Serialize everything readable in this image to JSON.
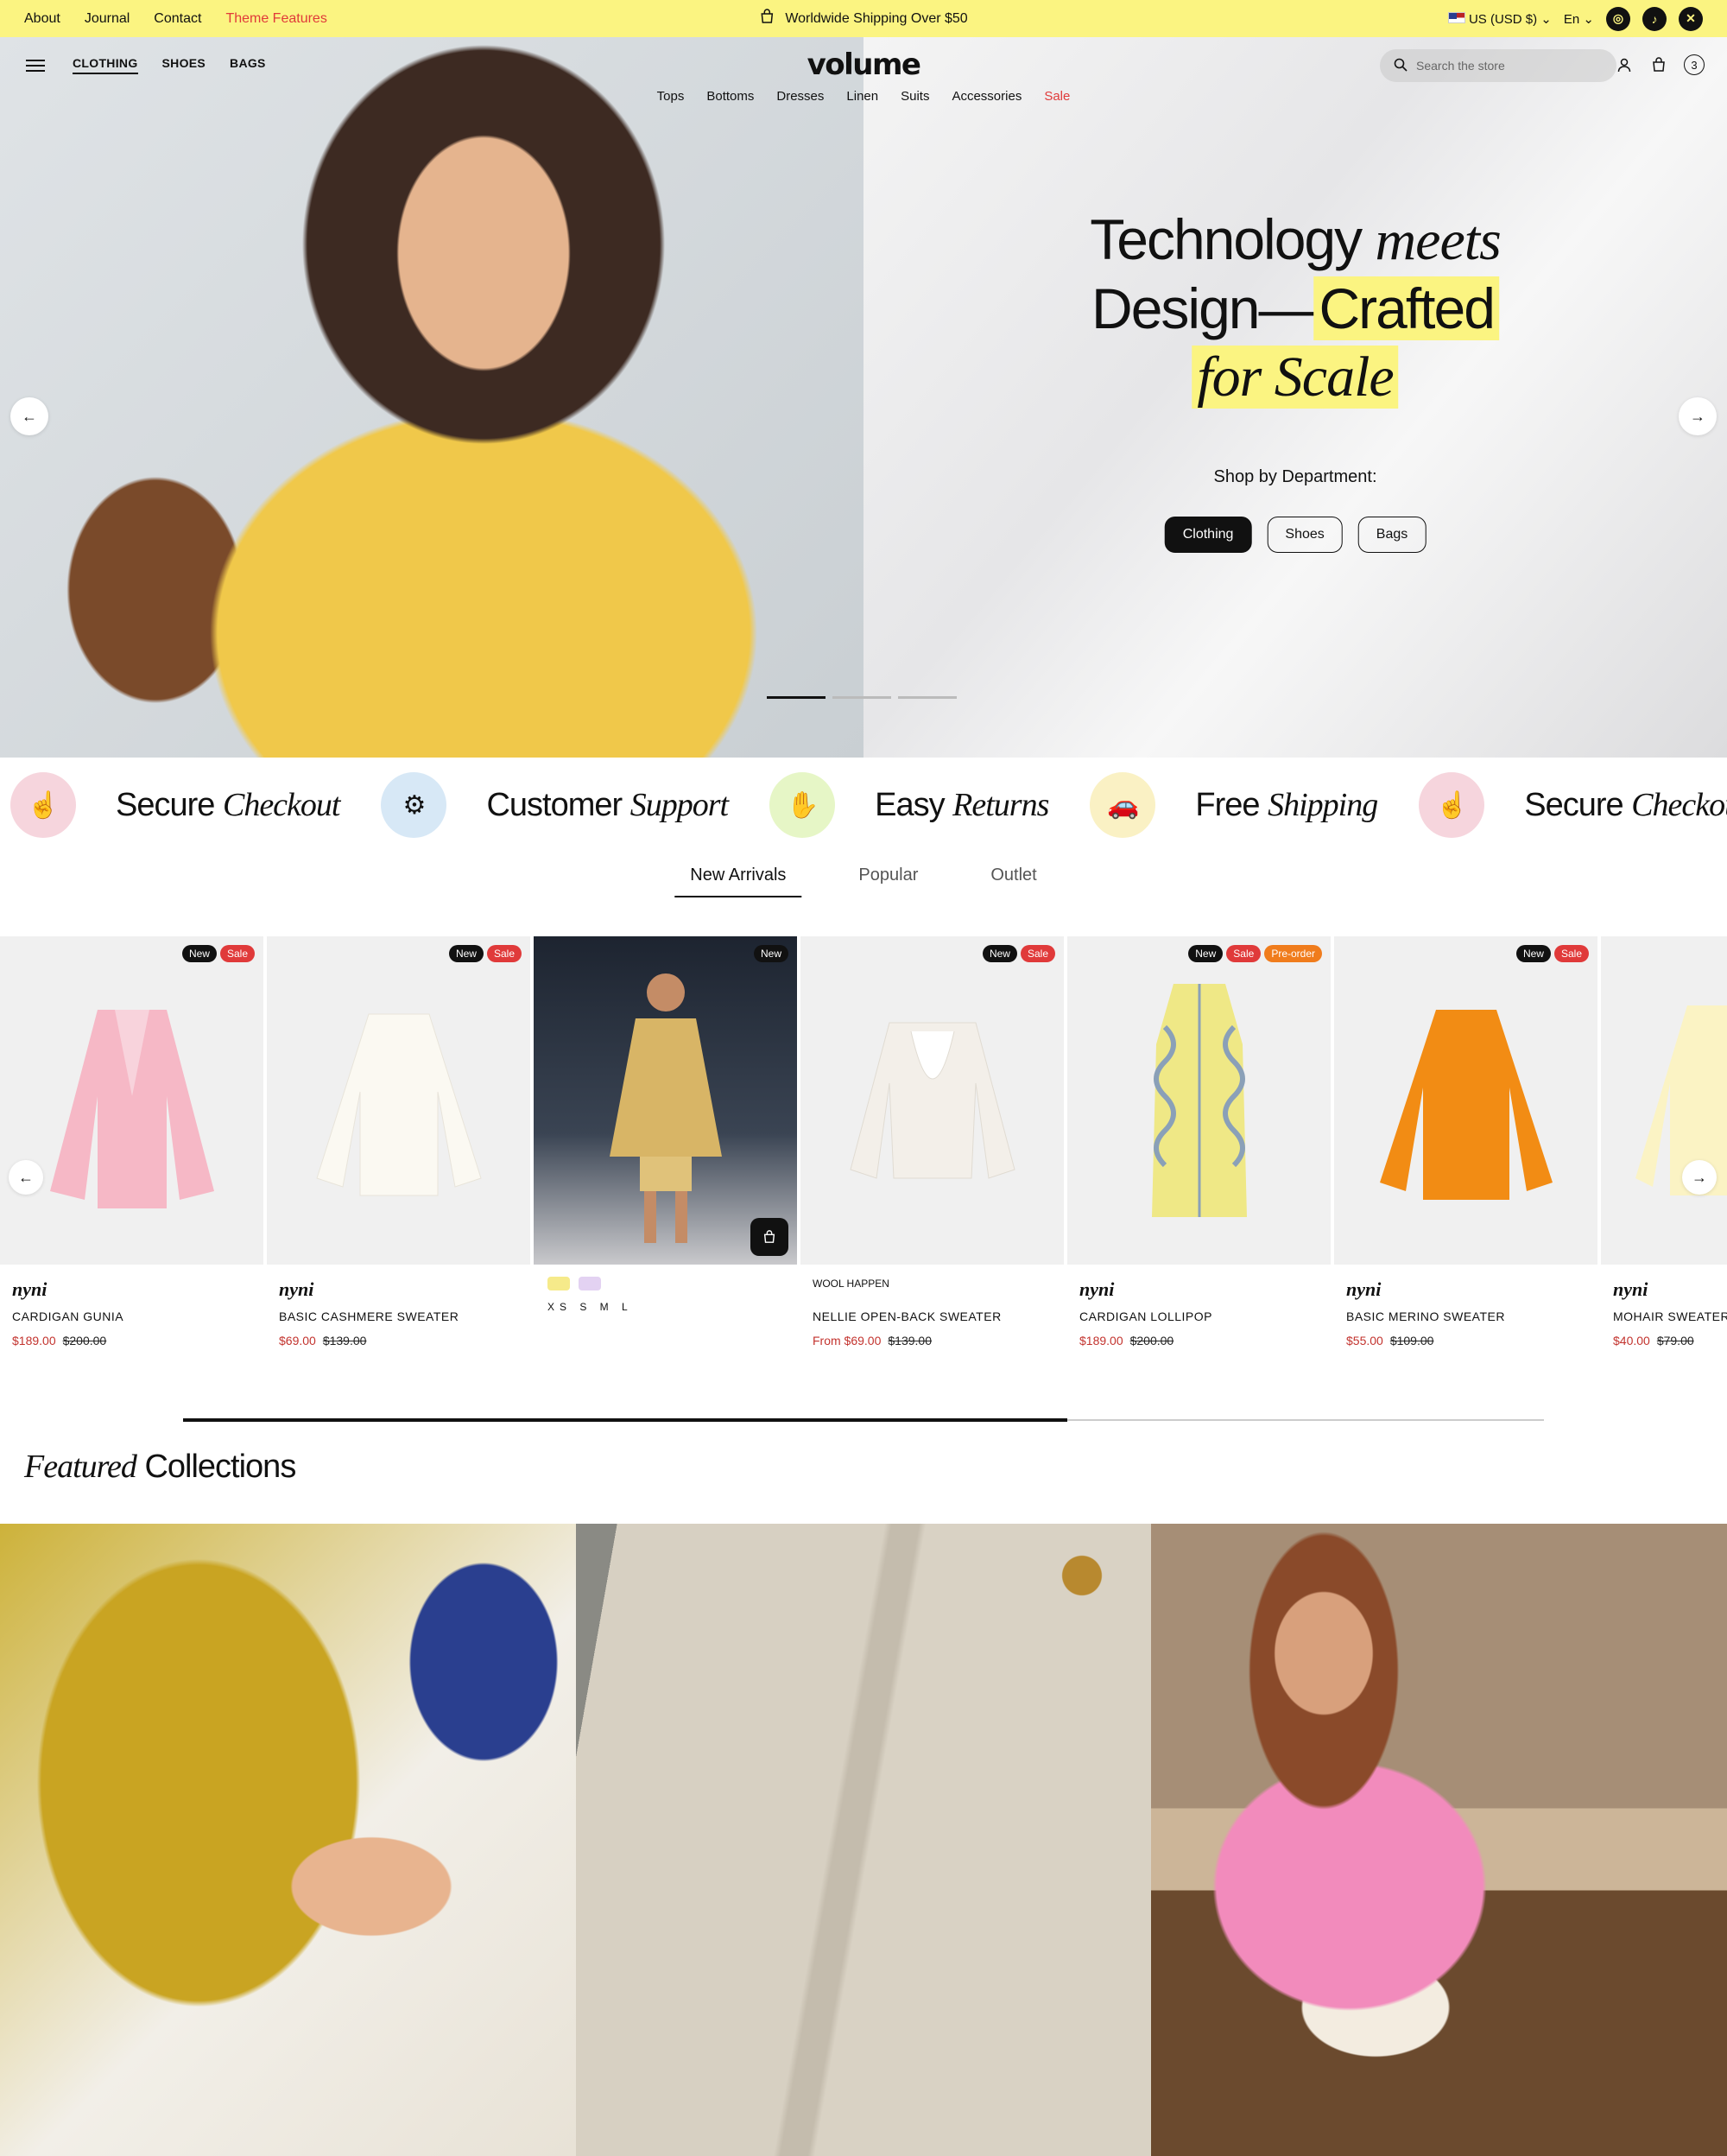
{
  "topbar": {
    "links": [
      "About",
      "Journal",
      "Contact"
    ],
    "theme_features": "Theme Features",
    "shipping": "Worldwide Shipping Over $50",
    "currency": "US (USD $)",
    "language": "En"
  },
  "nav": {
    "departments": [
      "CLOTHING",
      "SHOES",
      "BAGS"
    ],
    "logo": "volume",
    "categories": [
      "Tops",
      "Bottoms",
      "Dresses",
      "Linen",
      "Suits",
      "Accessories"
    ],
    "sale": "Sale",
    "search_placeholder": "Search the store",
    "cart_count": "3"
  },
  "hero": {
    "line1_a": "Technology",
    "line1_b": "meets",
    "line2_a": "Design—",
    "line2_b": "Crafted",
    "line3": "for Scale",
    "shop_by": "Shop by Department:",
    "buttons": [
      "Clothing",
      "Shoes",
      "Bags"
    ]
  },
  "features": [
    {
      "a": "Secure",
      "b": "Checkout"
    },
    {
      "a": "Customer",
      "b": "Support"
    },
    {
      "a": "Easy",
      "b": "Returns"
    },
    {
      "a": "Free",
      "b": "Shipping"
    },
    {
      "a": "Secure",
      "b": "Checkou"
    }
  ],
  "tabs": [
    "New Arrivals",
    "Popular",
    "Outlet"
  ],
  "products": [
    {
      "brand": "nyni",
      "name": "CARDIGAN GUNIA",
      "price": "$189.00",
      "old": "$200.00",
      "tags": [
        "New",
        "Sale"
      ]
    },
    {
      "brand": "nyni",
      "name": "BASIC CASHMERE SWEATER",
      "price": "$69.00",
      "old": "$139.00",
      "tags": [
        "New",
        "Sale"
      ]
    },
    {
      "brand": "",
      "name": "",
      "price": "",
      "old": "",
      "tags": [
        "New"
      ],
      "sizes": "XS S M L"
    },
    {
      "brand": "WOOL HAPPEN",
      "name": "NELLIE OPEN-BACK SWEATER",
      "price": "From $69.00",
      "old": "$139.00",
      "tags": [
        "New",
        "Sale"
      ]
    },
    {
      "brand": "nyni",
      "name": "CARDIGAN LOLLIPOP",
      "price": "$189.00",
      "old": "$200.00",
      "tags": [
        "New",
        "Sale",
        "Pre-order"
      ]
    },
    {
      "brand": "nyni",
      "name": "BASIC MERINO SWEATER",
      "price": "$55.00",
      "old": "$109.00",
      "tags": [
        "New",
        "Sale"
      ]
    },
    {
      "brand": "nyni",
      "name": "MOHAIR SWEATER",
      "price": "$40.00",
      "old": "$79.00",
      "tags": []
    }
  ],
  "featured": {
    "a": "Featured",
    "b": "Collections"
  },
  "colors": {
    "accent_yellow": "#fbf481",
    "sale_red": "#e03a3a",
    "preorder_orange": "#f07c1c"
  }
}
